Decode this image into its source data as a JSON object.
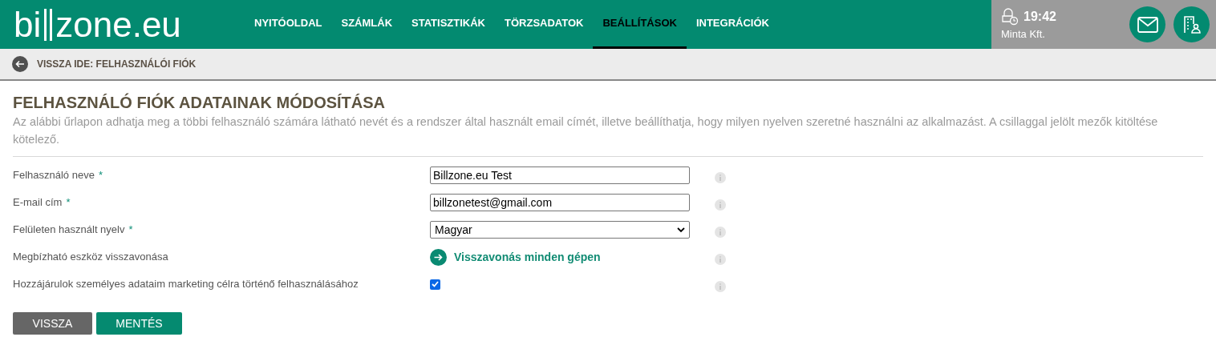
{
  "header": {
    "logo": {
      "before": "bi",
      "after": "zone.eu"
    },
    "nav": [
      {
        "label": "NYITÓOLDAL",
        "selected": false
      },
      {
        "label": "SZÁMLÁK",
        "selected": false
      },
      {
        "label": "STATISZTIKÁK",
        "selected": false
      },
      {
        "label": "TÖRZSADATOK",
        "selected": false
      },
      {
        "label": "BEÁLLÍTÁSOK",
        "selected": true
      },
      {
        "label": "INTEGRÁCIÓK",
        "selected": false
      }
    ],
    "session": {
      "time": "19:42",
      "company": "Minta Kft."
    }
  },
  "breadcrumb": {
    "label": "VISSZA IDE: FELHASZNÁLÓI FIÓK"
  },
  "form": {
    "title": "FELHASZNÁLÓ FIÓK ADATAINAK MÓDOSÍTÁSA",
    "description": "Az alábbi űrlapon adhatja meg a többi felhasználó számára látható nevét és a rendszer által használt email címét, illetve beállíthatja, hogy milyen nyelven szeretné használni az alkalmazást. A csillaggal jelölt mezők kitöltése kötelező.",
    "rows": [
      {
        "kind": "text",
        "label": "Felhasználó neve",
        "mark": "*",
        "value": "Billzone.eu Test"
      },
      {
        "kind": "text",
        "label": "E-mail cím",
        "mark": "*",
        "value": "billzonetest@gmail.com"
      },
      {
        "kind": "select",
        "label": "Felületen használt nyelv",
        "mark": "*",
        "value": "Magyar"
      },
      {
        "kind": "link",
        "label": "Megbízható eszköz visszavonása",
        "value": "Visszavonás minden gépen"
      },
      {
        "kind": "checkbox",
        "label": "Hozzájárulok személyes adataim marketing célra történő felhasználásához",
        "checked": true
      }
    ],
    "buttons": [
      {
        "kind": "secondary",
        "label": "VISSZA"
      },
      {
        "kind": "primary",
        "label": "MENTÉS"
      }
    ]
  }
}
